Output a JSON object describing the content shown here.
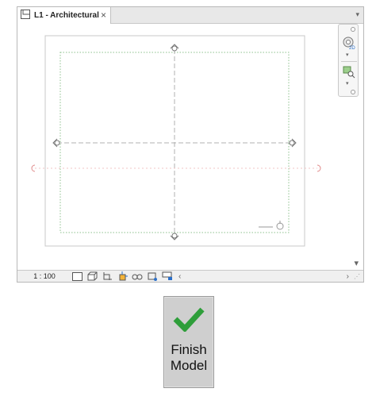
{
  "tab": {
    "title": "L1 - Architectural",
    "close": "×",
    "menu": "▾"
  },
  "statusbar": {
    "scale": "1 : 100",
    "icons": [
      "detail-level-icon",
      "visual-style-icon",
      "sun-path-icon",
      "shadows-icon",
      "render-icon",
      "crop-view-icon",
      "show-crop-icon"
    ]
  },
  "finish_button": {
    "line1": "Finish",
    "line2": "Model",
    "accent": "#2e9e3a"
  },
  "colors": {
    "guide": "#8cc08c",
    "dashed": "#b0b0b0",
    "section": "#d88a8a"
  }
}
